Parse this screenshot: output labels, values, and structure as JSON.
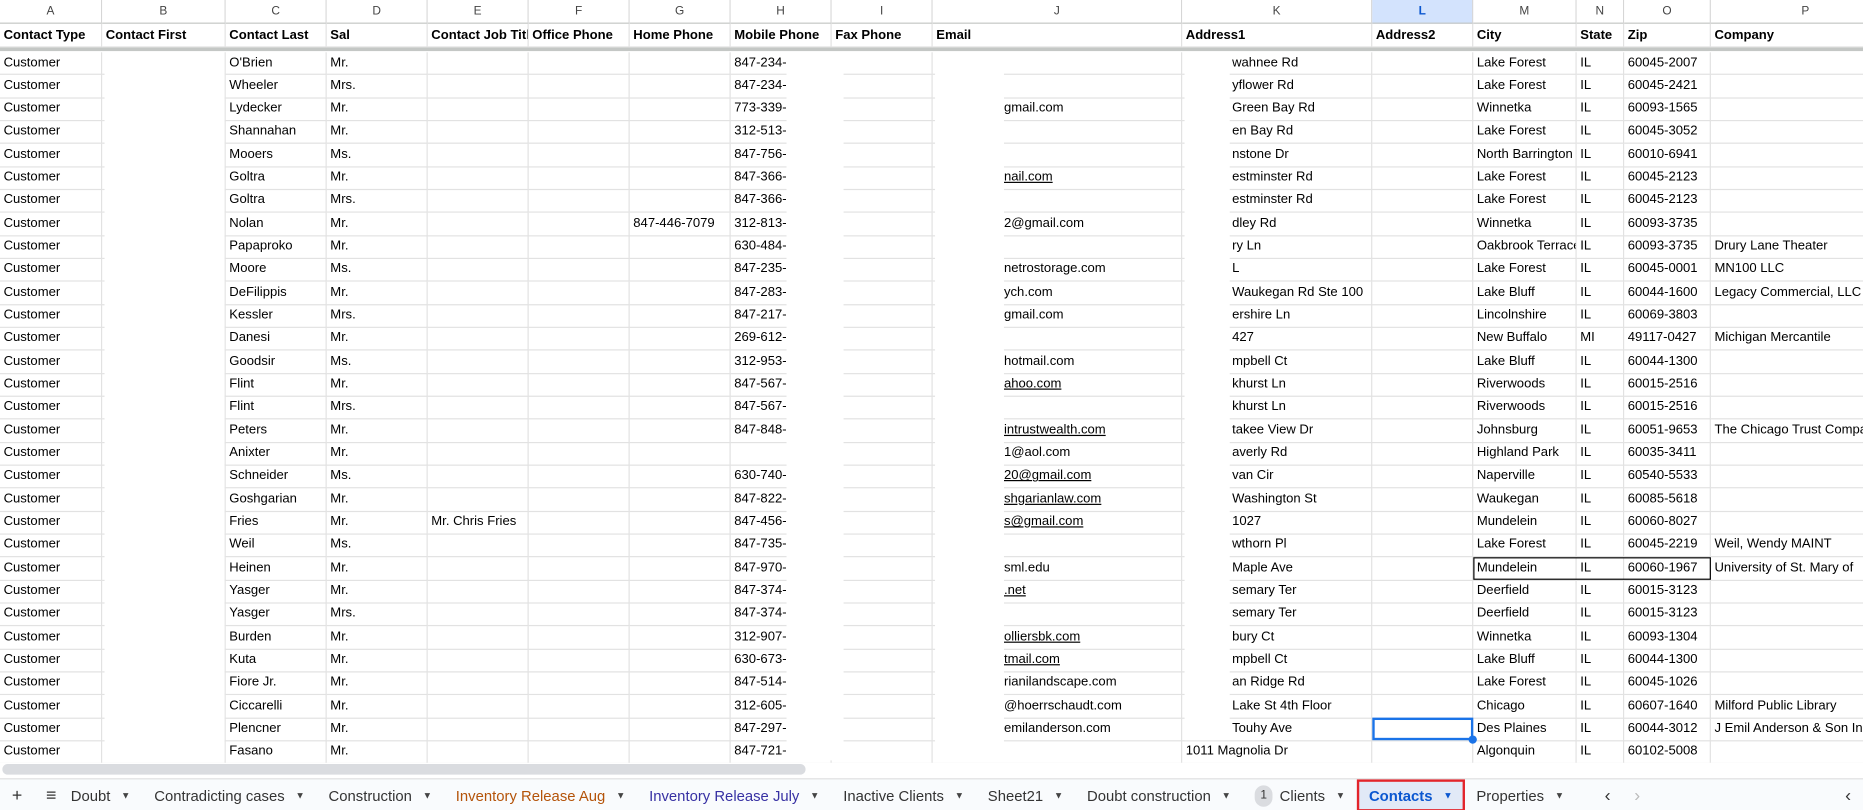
{
  "column_letters": [
    "A",
    "B",
    "C",
    "D",
    "E",
    "F",
    "G",
    "H",
    "I",
    "J",
    "K",
    "L",
    "M",
    "N",
    "O",
    "P"
  ],
  "selected_column": "L",
  "headers": [
    "Contact Type",
    "Contact First",
    "Contact Last",
    "Sal",
    "Contact Job Title",
    "Office Phone",
    "Home Phone",
    "Mobile Phone",
    "Fax Phone",
    "Email",
    "Address1",
    "Address2",
    "City",
    "State",
    "Zip",
    "Company"
  ],
  "rows": [
    [
      "Customer",
      "",
      "O'Brien",
      "Mr.",
      "",
      "",
      "",
      "847-234-",
      "",
      "",
      "wahnee Rd",
      "",
      "Lake Forest",
      "IL",
      "60045-2007",
      ""
    ],
    [
      "Customer",
      "",
      "Wheeler",
      "Mrs.",
      "",
      "",
      "",
      "847-234-",
      "",
      "",
      "yflower Rd",
      "",
      "Lake Forest",
      "IL",
      "60045-2421",
      ""
    ],
    [
      "Customer",
      "",
      "Lydecker",
      "Mr.",
      "",
      "",
      "",
      "773-339-",
      "",
      "gmail.com",
      "Green Bay Rd",
      "",
      "Winnetka",
      "IL",
      "60093-1565",
      ""
    ],
    [
      "Customer",
      "",
      "Shannahan",
      "Mr.",
      "",
      "",
      "",
      "312-513-",
      "",
      "",
      "en Bay Rd",
      "",
      "Lake Forest",
      "IL",
      "60045-3052",
      ""
    ],
    [
      "Customer",
      "",
      "Mooers",
      "Ms.",
      "",
      "",
      "",
      "847-756-",
      "",
      "",
      "nstone Dr",
      "",
      "North Barrington",
      "IL",
      "60010-6941",
      ""
    ],
    [
      "Customer",
      "",
      "Goltra",
      "Mr.",
      "",
      "",
      "",
      "847-366-",
      "",
      "nail.com",
      "estminster Rd",
      "",
      "Lake Forest",
      "IL",
      "60045-2123",
      ""
    ],
    [
      "Customer",
      "",
      "Goltra",
      "Mrs.",
      "",
      "",
      "",
      "847-366-",
      "",
      "",
      "estminster Rd",
      "",
      "Lake Forest",
      "IL",
      "60045-2123",
      ""
    ],
    [
      "Customer",
      "",
      "Nolan",
      "Mr.",
      "",
      "",
      "847-446-7079",
      "312-813-",
      "",
      "2@gmail.com",
      "dley Rd",
      "",
      "Winnetka",
      "IL",
      "60093-3735",
      ""
    ],
    [
      "Customer",
      "",
      "Papaproko",
      "Mr.",
      "",
      "",
      "",
      "630-484-",
      "",
      "",
      "ry Ln",
      "",
      "Oakbrook Terrace",
      "IL",
      "60093-3735",
      "Drury Lane Theater"
    ],
    [
      "Customer",
      "",
      "Moore",
      "Ms.",
      "",
      "",
      "",
      "847-235-",
      "",
      "netrostorage.com",
      "L",
      "",
      "Lake Forest",
      "IL",
      "60045-0001",
      "MN100 LLC"
    ],
    [
      "Customer",
      "",
      "DeFilippis",
      "Mr.",
      "",
      "",
      "",
      "847-283-",
      "",
      "ych.com",
      "Waukegan Rd Ste 100",
      "",
      "Lake Bluff",
      "IL",
      "60044-1600",
      "Legacy Commercial, LLC"
    ],
    [
      "Customer",
      "",
      "Kessler",
      "Mrs.",
      "",
      "",
      "",
      "847-217-",
      "",
      "gmail.com",
      "ershire Ln",
      "",
      "Lincolnshire",
      "IL",
      "60069-3803",
      ""
    ],
    [
      "Customer",
      "",
      "Danesi",
      "Mr.",
      "",
      "",
      "",
      "269-612-",
      "",
      "",
      "427",
      "",
      "New Buffalo",
      "MI",
      "49117-0427",
      "Michigan Mercantile"
    ],
    [
      "Customer",
      "",
      "Goodsir",
      "Ms.",
      "",
      "",
      "",
      "312-953-",
      "",
      "hotmail.com",
      "mpbell Ct",
      "",
      "Lake Bluff",
      "IL",
      "60044-1300",
      ""
    ],
    [
      "Customer",
      "",
      "Flint",
      "Mr.",
      "",
      "",
      "",
      "847-567-",
      "",
      "ahoo.com",
      "khurst Ln",
      "",
      "Riverwoods",
      "IL",
      "60015-2516",
      ""
    ],
    [
      "Customer",
      "",
      "Flint",
      "Mrs.",
      "",
      "",
      "",
      "847-567-",
      "",
      "",
      "khurst Ln",
      "",
      "Riverwoods",
      "IL",
      "60015-2516",
      ""
    ],
    [
      "Customer",
      "",
      "Peters",
      "Mr.",
      "",
      "",
      "",
      "847-848-",
      "",
      "intrustwealth.com",
      "takee View Dr",
      "",
      "Johnsburg",
      "IL",
      "60051-9653",
      "The Chicago Trust Compa"
    ],
    [
      "Customer",
      "",
      "Anixter",
      "Mr.",
      "",
      "",
      "",
      "",
      "",
      "1@aol.com",
      "averly Rd",
      "",
      "Highland Park",
      "IL",
      "60035-3411",
      ""
    ],
    [
      "Customer",
      "",
      "Schneider",
      "Ms.",
      "",
      "",
      "",
      "630-740-",
      "",
      "20@gmail.com",
      "van Cir",
      "",
      "Naperville",
      "IL",
      "60540-5533",
      ""
    ],
    [
      "Customer",
      "",
      "Goshgarian",
      "Mr.",
      "",
      "",
      "",
      "847-822-",
      "",
      "shgarianlaw.com",
      "Washington St",
      "",
      "Waukegan",
      "IL",
      "60085-5618",
      ""
    ],
    [
      "Customer",
      "",
      "Fries",
      "Mr.",
      "Mr. Chris Fries",
      "",
      "",
      "847-456-",
      "",
      "s@gmail.com",
      "1027",
      "",
      "Mundelein",
      "IL",
      "60060-8027",
      ""
    ],
    [
      "Customer",
      "",
      "Weil",
      "Ms.",
      "",
      "",
      "",
      "847-735-",
      "",
      "",
      "wthorn Pl",
      "",
      "Lake Forest",
      "IL",
      "60045-2219",
      "Weil, Wendy MAINT"
    ],
    [
      "Customer",
      "",
      "Heinen",
      "Mr.",
      "",
      "",
      "",
      "847-970-",
      "",
      "sml.edu",
      "Maple Ave",
      "",
      "Mundelein",
      "IL",
      "60060-1967",
      "University of St. Mary of"
    ],
    [
      "Customer",
      "",
      "Yasger",
      "Mr.",
      "",
      "",
      "",
      "847-374-",
      "",
      ".net",
      "semary Ter",
      "",
      "Deerfield",
      "IL",
      "60015-3123",
      ""
    ],
    [
      "Customer",
      "",
      "Yasger",
      "Mrs.",
      "",
      "",
      "",
      "847-374-",
      "",
      "",
      "semary Ter",
      "",
      "Deerfield",
      "IL",
      "60015-3123",
      ""
    ],
    [
      "Customer",
      "",
      "Burden",
      "Mr.",
      "",
      "",
      "",
      "312-907-",
      "",
      "olliersbk.com",
      "bury Ct",
      "",
      "Winnetka",
      "IL",
      "60093-1304",
      ""
    ],
    [
      "Customer",
      "",
      "Kuta",
      "Mr.",
      "",
      "",
      "",
      "630-673-",
      "",
      "tmail.com",
      "mpbell Ct",
      "",
      "Lake Bluff",
      "IL",
      "60044-1300",
      ""
    ],
    [
      "Customer",
      "",
      "Fiore Jr.",
      "Mr.",
      "",
      "",
      "",
      "847-514-",
      "",
      "rianilandscape.com",
      "an Ridge Rd",
      "",
      "Lake Forest",
      "IL",
      "60045-1026",
      ""
    ],
    [
      "Customer",
      "",
      "Ciccarelli",
      "Mr.",
      "",
      "",
      "",
      "312-605-",
      "",
      "@hoerrschaudt.com",
      "Lake St 4th Floor",
      "",
      "Chicago",
      "IL",
      "60607-1640",
      "Milford Public Library"
    ],
    [
      "Customer",
      "",
      "Plencner",
      "Mr.",
      "",
      "",
      "",
      "847-297-",
      "",
      "emilanderson.com",
      "Touhy Ave",
      "",
      "Des Plaines",
      "IL",
      "60044-3012",
      "J Emil Anderson & Son In"
    ],
    [
      "Customer",
      "",
      "Fasano",
      "Mr.",
      "",
      "",
      "",
      "847-721-",
      "",
      "",
      "1011 Magnolia Dr",
      "",
      "Algonquin",
      "IL",
      "60102-5008",
      ""
    ]
  ],
  "underlined_email_rows": [
    5,
    14,
    16,
    18,
    19,
    20,
    23,
    25,
    26
  ],
  "selected_cell": {
    "column": "L",
    "row": 30
  },
  "selection_range": "M23:O23",
  "tabs": {
    "add_icon": "plus-icon",
    "menu_icon": "all-sheets-icon",
    "items": [
      {
        "label": "Doubt",
        "color": "#333333"
      },
      {
        "label": "Contradicting cases",
        "color": "#333333"
      },
      {
        "label": "Construction",
        "color": "#333333"
      },
      {
        "label": "Inventory Release Aug",
        "color": "#b45309"
      },
      {
        "label": "Inventory Release July",
        "color": "#3730a3"
      },
      {
        "label": "Inactive Clients",
        "color": "#333333"
      },
      {
        "label": "Sheet21",
        "color": "#333333"
      },
      {
        "label": "Doubt construction",
        "color": "#333333"
      },
      {
        "label": "Clients",
        "badge": "1",
        "color": "#333333"
      },
      {
        "label": "Contacts",
        "active": true,
        "color": "#0b57d0"
      },
      {
        "label": "Properties",
        "color": "#333333"
      }
    ],
    "prev_label": "‹",
    "next_label": "›",
    "collapse_label": "‹"
  },
  "colors": {
    "accent": "#0b57d0",
    "highlight_box": "#e3242b"
  }
}
